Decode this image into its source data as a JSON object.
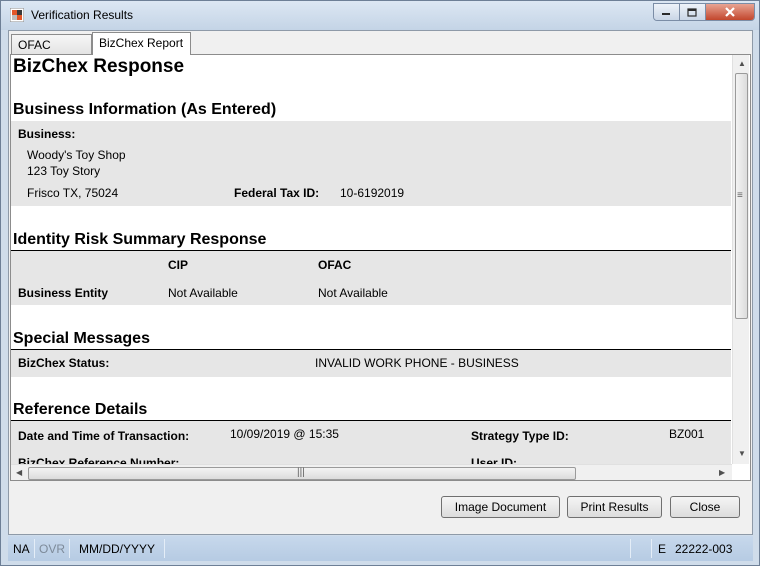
{
  "window": {
    "title": "Verification Results"
  },
  "tabs": [
    {
      "label": "OFAC Report",
      "active": false
    },
    {
      "label": "BizChex Report",
      "active": true
    }
  ],
  "report": {
    "title": "BizChex Response",
    "business_info": {
      "heading": "Business Information (As Entered)",
      "business_label": "Business:",
      "name": "Woody's Toy Shop",
      "address": "123 Toy Story",
      "city_state_zip": "Frisco TX, 75024",
      "tax_id_label": "Federal Tax ID:",
      "tax_id": "10-6192019"
    },
    "identity_risk": {
      "heading": "Identity Risk Summary Response",
      "col_cip": "CIP",
      "col_ofac": "OFAC",
      "row_label": "Business Entity",
      "cip_value": "Not Available",
      "ofac_value": "Not Available"
    },
    "special_messages": {
      "heading": "Special Messages",
      "status_label": "BizChex Status:",
      "status_value": "INVALID WORK PHONE - BUSINESS"
    },
    "reference_details": {
      "heading": "Reference Details",
      "datetime_label": "Date and Time of Transaction:",
      "datetime_value": "10/09/2019 @ 15:35",
      "strategy_label": "Strategy Type ID:",
      "strategy_value": "BZ001",
      "ref_number_label": "BizChex Reference Number:",
      "user_id_label": "User ID:"
    }
  },
  "buttons": {
    "image_document": "Image Document",
    "print_results": "Print Results",
    "close": "Close"
  },
  "statusbar": {
    "na": "NA",
    "ovr": "OVR",
    "date_format": "MM/DD/YYYY",
    "mode": "E",
    "code": "22222-003"
  },
  "colors": {
    "statusbar": "#b8cde4",
    "band": "#e6e6e6",
    "close_button": "#c7503a"
  }
}
